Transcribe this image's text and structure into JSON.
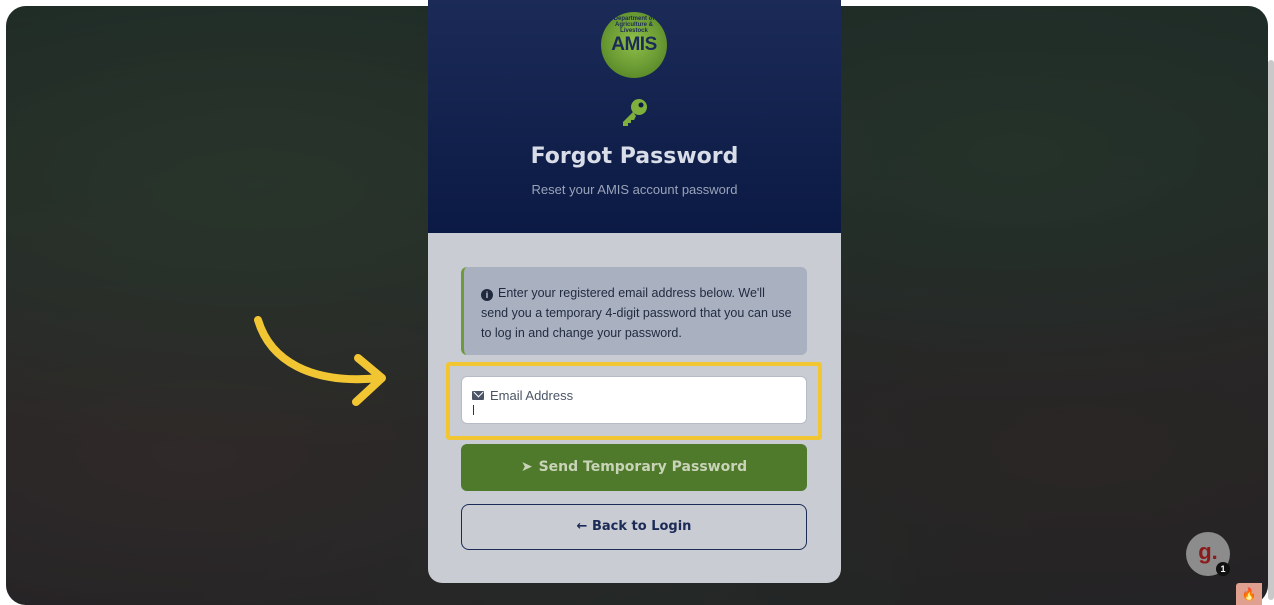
{
  "header": {
    "logo_text": "AMIS",
    "logo_ring": "Department of Agriculture & Livestock",
    "title": "Forgot Password",
    "subtitle": "Reset your AMIS account password",
    "key_icon": "key-icon"
  },
  "info": {
    "icon": "info-circle-icon",
    "text": "Enter your registered email address below. We'll send you a temporary 4-digit password that you can use to log in and change your password."
  },
  "email_field": {
    "label": "Email Address",
    "icon": "envelope-icon",
    "value": ""
  },
  "buttons": {
    "send_label": "Send Temporary Password",
    "send_icon": "paper-plane-icon",
    "back_label": "← Back to Login"
  },
  "widget": {
    "letter": "g.",
    "count": "1"
  },
  "colors": {
    "header_bg": "#0b1a44",
    "accent_green": "#4f7a2c",
    "highlight": "#f2c633",
    "navy": "#1b2a57"
  }
}
